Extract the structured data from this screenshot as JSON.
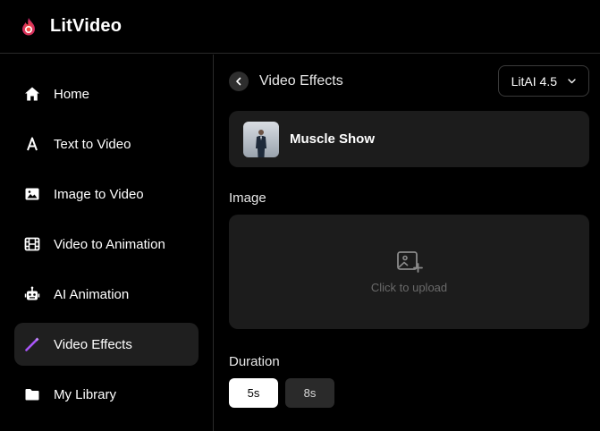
{
  "app": {
    "name": "LitVideo",
    "logo_icon": "flame-icon",
    "accent": "#e8254a"
  },
  "sidebar": {
    "items": [
      {
        "label": "Home",
        "icon": "home-icon"
      },
      {
        "label": "Text to Video",
        "icon": "text-a-icon"
      },
      {
        "label": "Image to Video",
        "icon": "image-icon"
      },
      {
        "label": "Video to Animation",
        "icon": "film-icon"
      },
      {
        "label": "AI Animation",
        "icon": "robot-icon"
      },
      {
        "label": "Video Effects",
        "icon": "wand-icon",
        "active": true,
        "icon_color": "#a855f7"
      },
      {
        "label": "My Library",
        "icon": "folder-icon"
      }
    ]
  },
  "main": {
    "title": "Video Effects",
    "model": {
      "selected": "LitAI 4.5"
    },
    "effect": {
      "name": "Muscle Show"
    },
    "image_section": {
      "label": "Image",
      "upload_text": "Click to upload"
    },
    "duration": {
      "label": "Duration",
      "options": [
        "5s",
        "8s"
      ],
      "selected": "5s"
    }
  }
}
